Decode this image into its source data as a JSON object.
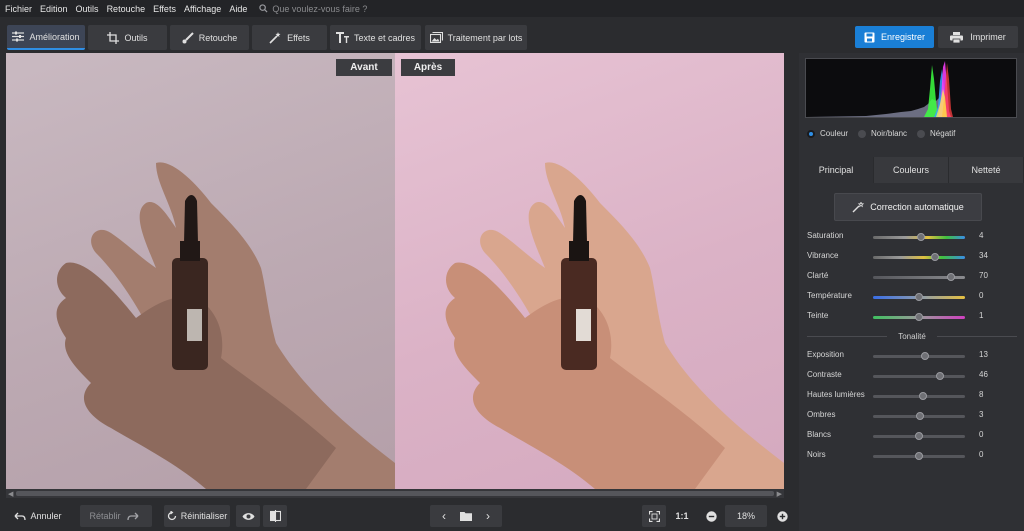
{
  "menu": {
    "items": [
      "Fichier",
      "Edition",
      "Outils",
      "Retouche",
      "Effets",
      "Affichage",
      "Aide"
    ],
    "search_placeholder": "Que voulez-vous faire ?"
  },
  "toolbar": {
    "tabs": [
      {
        "label": "Amélioration",
        "icon": "sliders-icon"
      },
      {
        "label": "Outils",
        "icon": "crop-icon"
      },
      {
        "label": "Retouche",
        "icon": "brush-icon"
      },
      {
        "label": "Effets",
        "icon": "magic-wand-icon"
      },
      {
        "label": "Texte et cadres",
        "icon": "text-icon"
      },
      {
        "label": "Traitement par lots",
        "icon": "batch-images-icon"
      }
    ],
    "active_tab": "Amélioration",
    "save_label": "Enregistrer",
    "print_label": "Imprimer"
  },
  "canvas": {
    "before_label": "Avant",
    "after_label": "Après"
  },
  "panel": {
    "color_modes": [
      "Couleur",
      "Noir/blanc",
      "Négatif"
    ],
    "selected_color_mode": "Couleur",
    "tabs": [
      "Principal",
      "Couleurs",
      "Netteté"
    ],
    "active_tab": "Principal",
    "auto_correction_label": "Correction automatique",
    "sliders": [
      {
        "label": "Saturation",
        "value": "4",
        "level": 0.52,
        "track": "saturation"
      },
      {
        "label": "Vibrance",
        "value": "34",
        "level": 0.67,
        "track": "vibrance"
      },
      {
        "label": "Clarté",
        "value": "70",
        "level": 0.85,
        "track": "gray"
      },
      {
        "label": "Température",
        "value": "0",
        "level": 0.5,
        "track": "temperature"
      },
      {
        "label": "Teinte",
        "value": "1",
        "level": 0.5,
        "track": "tint"
      }
    ],
    "tonal_heading": "Tonalité",
    "tonal_sliders": [
      {
        "label": "Exposition",
        "value": "13",
        "level": 0.57
      },
      {
        "label": "Contraste",
        "value": "46",
        "level": 0.73
      },
      {
        "label": "Hautes lumières",
        "value": "8",
        "level": 0.54
      },
      {
        "label": "Ombres",
        "value": "3",
        "level": 0.51
      },
      {
        "label": "Blancs",
        "value": "0",
        "level": 0.5
      },
      {
        "label": "Noirs",
        "value": "0",
        "level": 0.5
      }
    ]
  },
  "bottom": {
    "undo_label": "Annuler",
    "redo_label": "Rétablir",
    "reset_label": "Réinitialiser",
    "zoom_ratio_label": "1:1",
    "zoom_level": "18%"
  },
  "colors": {
    "accent": "#1a7fd6",
    "before_bg": "#c2b0b9",
    "after_bg": "#deb6ca"
  }
}
